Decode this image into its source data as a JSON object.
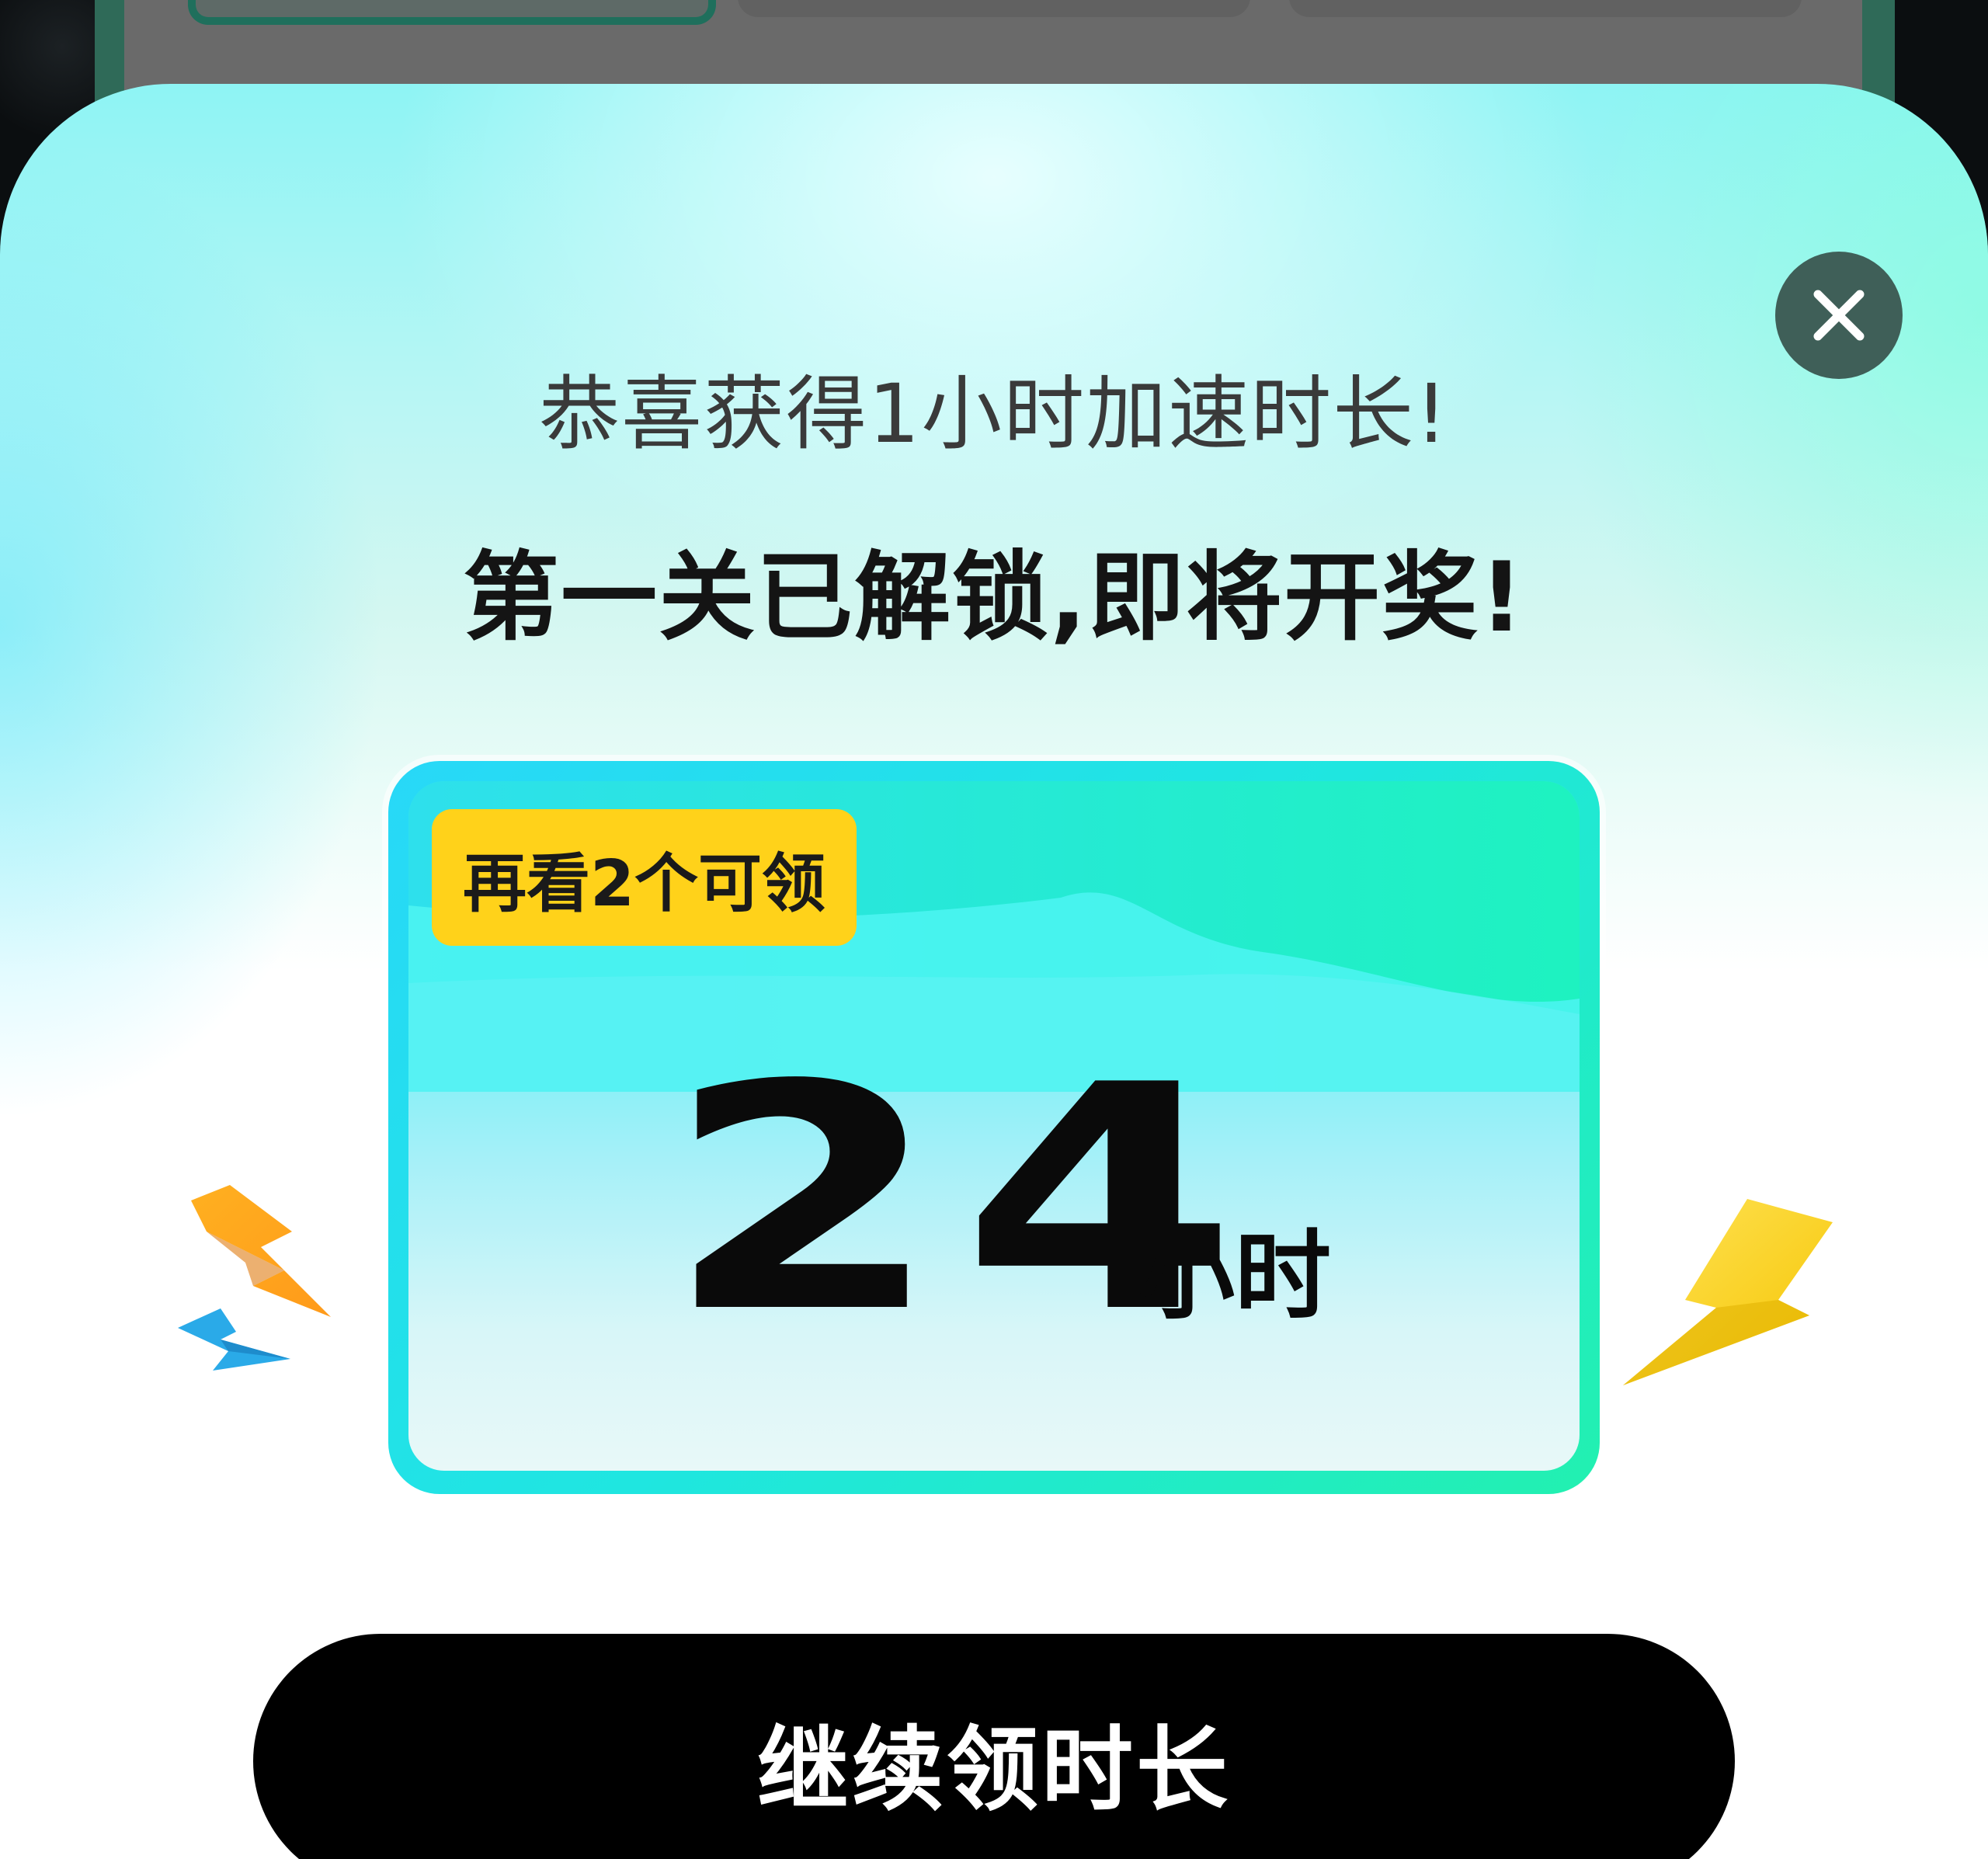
{
  "background": {
    "tabs": [
      "",
      "",
      ""
    ]
  },
  "modal": {
    "close_icon": "close-icon",
    "subtitle": "恭喜获得1小时加速时长!",
    "headline": "第一关已解锁,即将开奖!",
    "card": {
      "badge": "再看2个可领",
      "amount": "24",
      "unit": "小时"
    },
    "decorations": [
      "lightning-icon",
      "lightning-icon",
      "lightning-icon"
    ],
    "cta_label": "继续领时长"
  },
  "colors": {
    "accent_teal": "#22e8d8",
    "badge_yellow": "#ffd21a",
    "button_black": "#000000",
    "close_bg": "#3f5f58"
  }
}
